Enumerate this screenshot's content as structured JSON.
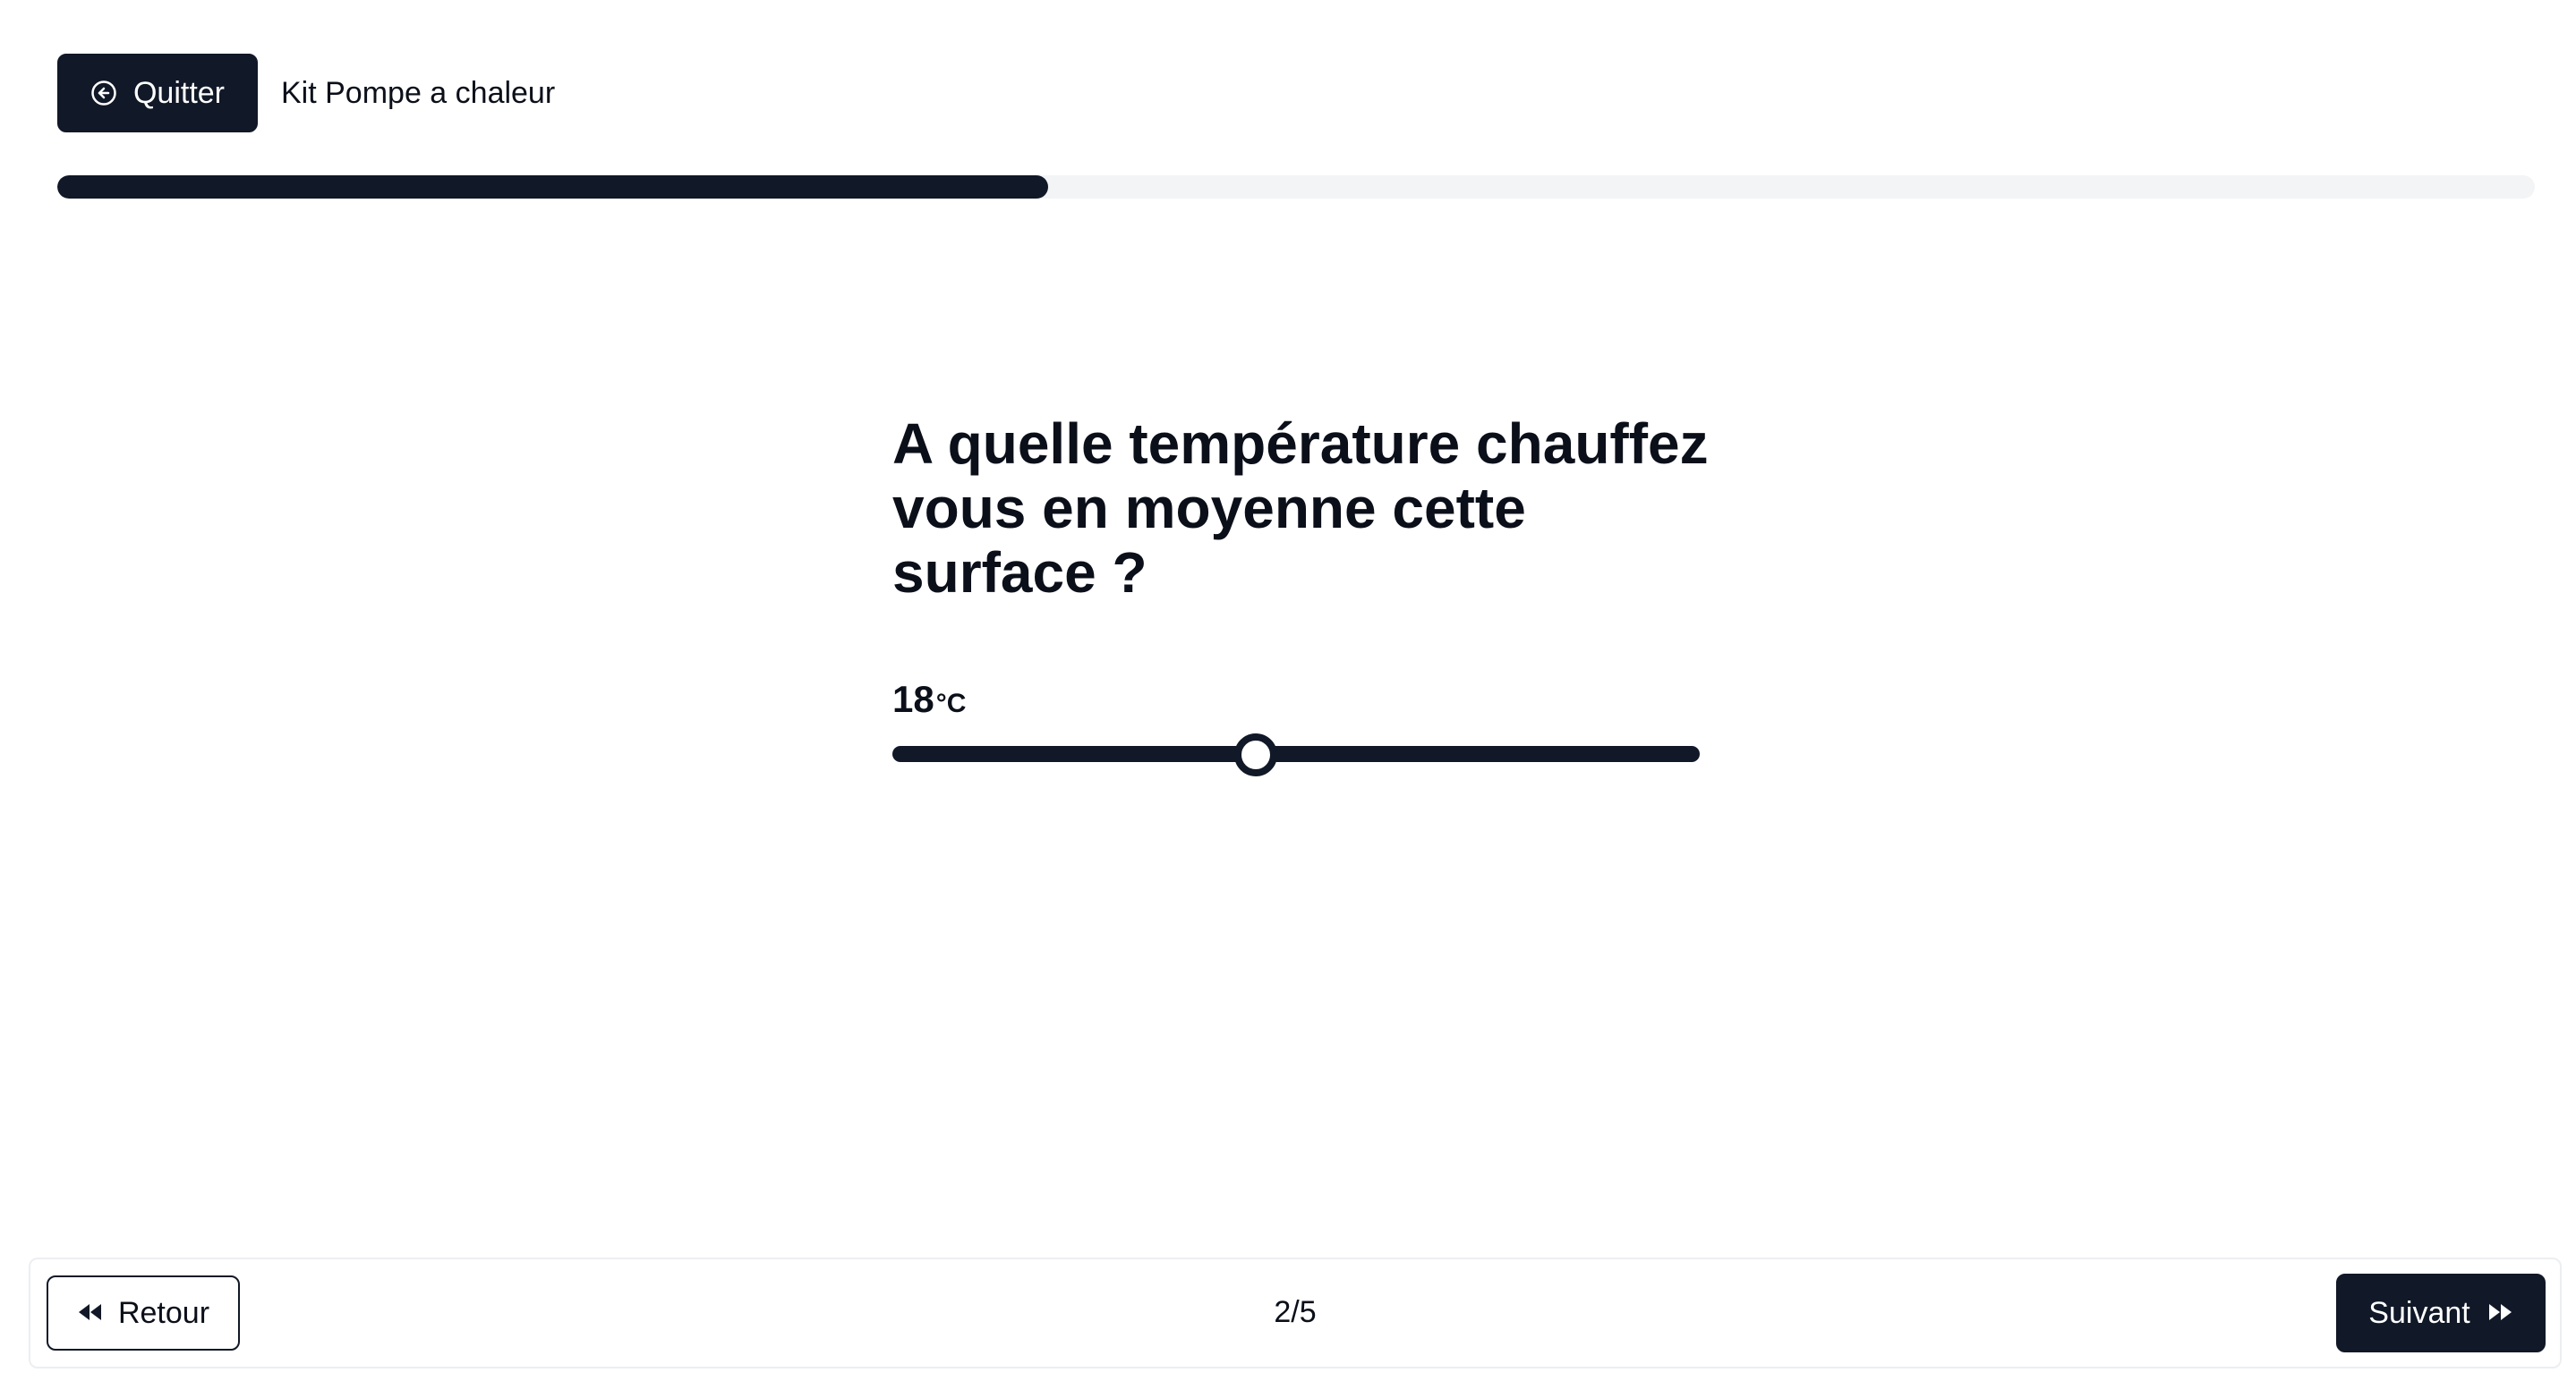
{
  "header": {
    "quit_label": "Quitter",
    "title": "Kit Pompe a chaleur"
  },
  "progress": {
    "fraction": 0.4
  },
  "question": {
    "text": "A quelle température chauffez vous en moyenne cette surface ?"
  },
  "slider": {
    "value": "18",
    "unit": "°C",
    "position_fraction": 0.45
  },
  "footer": {
    "back_label": "Retour",
    "pager": "2/5",
    "next_label": "Suivant"
  },
  "icons": {
    "quit": "circle-arrow-left-icon",
    "back": "rewind-icon",
    "next": "fast-forward-icon"
  },
  "colors": {
    "primary": "#111827",
    "track_bg": "#f3f4f6"
  }
}
